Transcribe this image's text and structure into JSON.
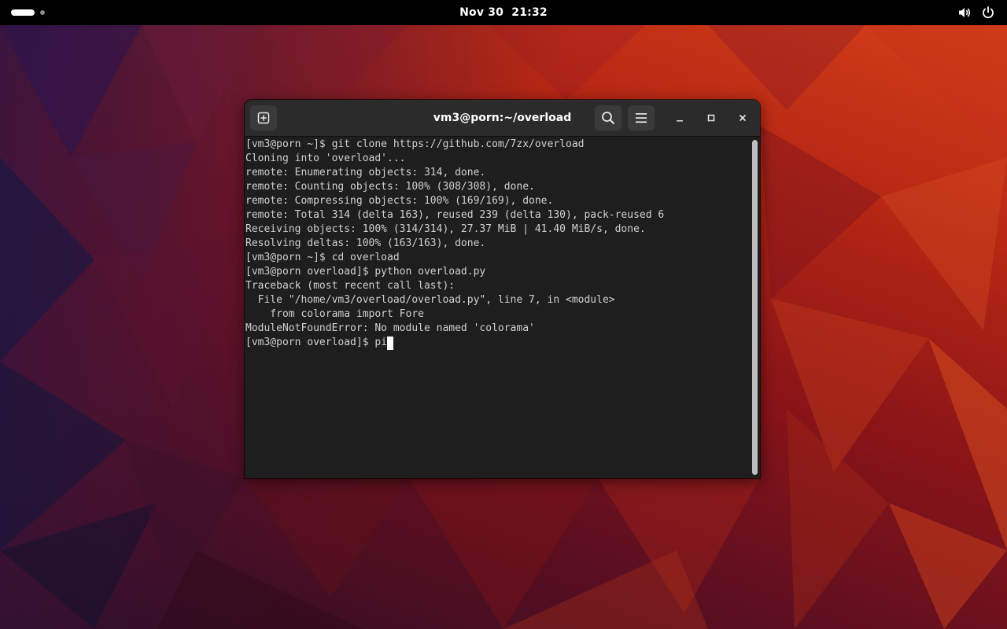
{
  "topbar": {
    "clock_date": "Nov 30",
    "clock_time": "21:32",
    "icons": {
      "activities": "activities-indicator",
      "volume": "volume-icon",
      "power": "power-icon"
    }
  },
  "terminal": {
    "title": "vm3@porn:~/overload",
    "icons": {
      "new_tab": "new-tab-icon",
      "search": "search-icon",
      "menu": "hamburger-menu-icon",
      "minimize": "minimize-icon",
      "maximize": "maximize-icon",
      "close": "close-icon"
    },
    "lines": [
      "[vm3@porn ~]$ git clone https://github.com/7zx/overload",
      "Cloning into 'overload'...",
      "remote: Enumerating objects: 314, done.",
      "remote: Counting objects: 100% (308/308), done.",
      "remote: Compressing objects: 100% (169/169), done.",
      "remote: Total 314 (delta 163), reused 239 (delta 130), pack-reused 6",
      "Receiving objects: 100% (314/314), 27.37 MiB | 41.40 MiB/s, done.",
      "Resolving deltas: 100% (163/163), done.",
      "[vm3@porn ~]$ cd overload",
      "[vm3@porn overload]$ python overload.py",
      "Traceback (most recent call last):",
      "  File \"/home/vm3/overload/overload.py\", line 7, in <module>",
      "    from colorama import Fore",
      "ModuleNotFoundError: No module named 'colorama'"
    ],
    "current_prompt": "[vm3@porn overload]$ pi"
  },
  "colors": {
    "topbar_bg": "#000000",
    "headerbar_bg": "#2b2b2b",
    "terminal_bg": "#1e1e1e",
    "terminal_fg": "#d0d0d0",
    "wallpaper_accent": "#d9421a"
  }
}
